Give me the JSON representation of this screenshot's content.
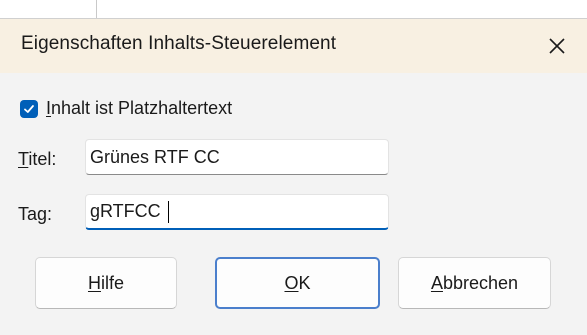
{
  "dialog": {
    "title": "Eigenschaften Inhalts-Steuerelement",
    "close_icon": "close-icon"
  },
  "placeholder_checkbox": {
    "checked": true,
    "label_access_key": "I",
    "label_rest": "nhalt ist Platzhaltertext"
  },
  "title_field": {
    "label_access_key": "T",
    "label_rest": "itel:",
    "value": "Grünes RTF CC"
  },
  "tag_field": {
    "label_start": "Ta",
    "label_access_key": "g",
    "label_end": ":",
    "value": "gRTFCC"
  },
  "buttons": {
    "help": {
      "access_key": "H",
      "rest": "ilfe"
    },
    "ok": {
      "access_key": "O",
      "rest": "K"
    },
    "cancel": {
      "access_key": "A",
      "rest": "bbrechen"
    }
  },
  "colors": {
    "titlebar": "#f8f0e2",
    "accent": "#005fb8",
    "dialog_bg": "#f3f3f3"
  }
}
